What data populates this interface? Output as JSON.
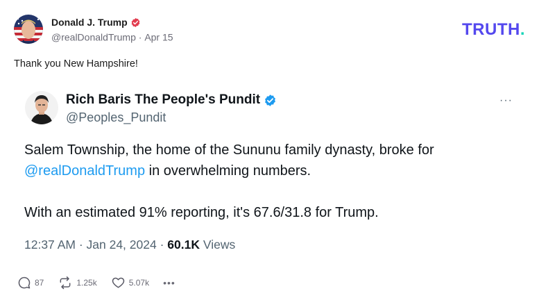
{
  "post": {
    "author_name": "Donald J. Trump",
    "handle": "@realDonaldTrump",
    "separator": "·",
    "date": "Apr 15",
    "text": "Thank you New Hampshire!"
  },
  "brand": {
    "logo_text": "TRUTH",
    "logo_dot": "."
  },
  "quote": {
    "author_name": "Rich Baris The People's Pundit",
    "handle": "@Peoples_Pundit",
    "more": "···",
    "line1": "Salem Township, the home of the Sununu family dynasty, broke for",
    "mention": "@realDonaldTrump",
    "line2_rest": " in overwhelming numbers.",
    "line3": "With an estimated 91% reporting, it's 67.6/31.8 for Trump.",
    "time": "12:37 AM",
    "meta_separator": " · ",
    "date": "Jan 24, 2024",
    "views_count": "60.1K",
    "views_label": " Views"
  },
  "actions": {
    "replies": "87",
    "retruths": "1.25k",
    "likes": "5.07k",
    "more": "•••"
  },
  "icons": {
    "verified_red": "verified-badge-icon",
    "verified_blue": "verified-badge-icon",
    "reply": "comment-icon",
    "retruth": "repost-icon",
    "like": "heart-icon",
    "more": "more-icon"
  },
  "colors": {
    "brand": "#5448ee",
    "brand_dot": "#16d4b8",
    "verified_red": "#e23c4f",
    "verified_blue": "#1d9bf0",
    "mention": "#1d9bf0"
  }
}
